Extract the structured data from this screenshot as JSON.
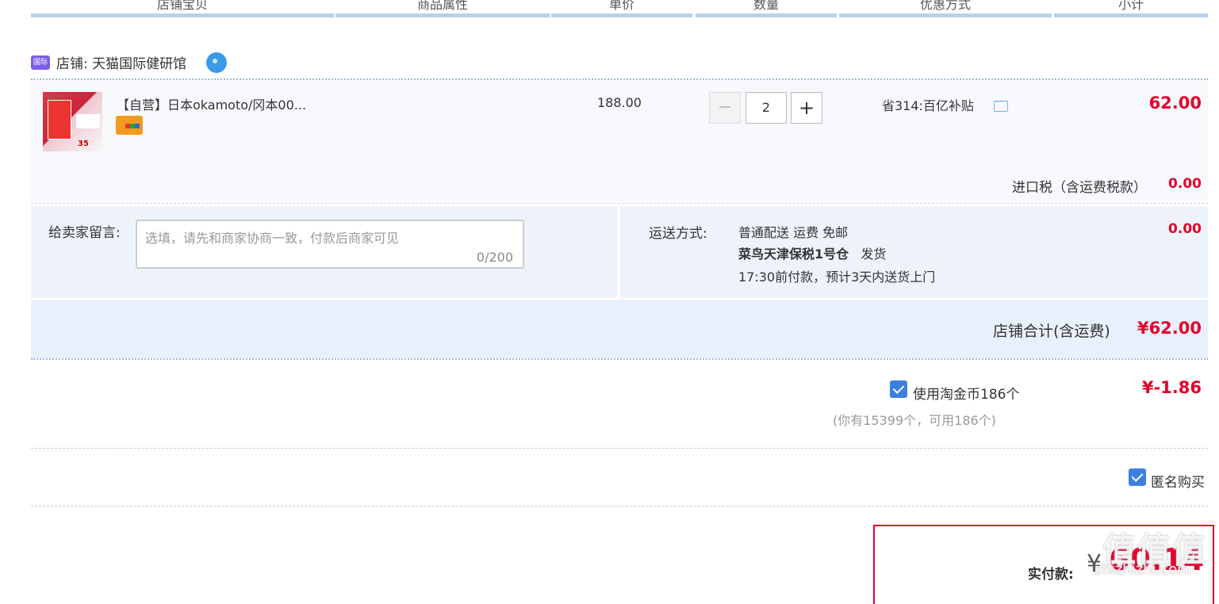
{
  "header": {
    "columns": [
      "店铺宝贝",
      "商品属性",
      "单价",
      "数量",
      "优惠方式",
      "小计"
    ]
  },
  "shop": {
    "label": "店铺: 天猫国际健研馆",
    "badge_icon": "tmall-global-icon",
    "chat_icon": "wangwang-icon"
  },
  "item": {
    "title": "【自营】日本okamoto/冈本00...",
    "price": "188.00",
    "quantity": "2",
    "promo": "省314:百亿补贴",
    "subtotal": "62.00",
    "tax_label": "进口税（含运费税款）",
    "tax_value": "0.00"
  },
  "message": {
    "label": "给卖家留言:",
    "placeholder": "选填，请先和商家协商一致，付款后商家可见",
    "counter": "0/200"
  },
  "shipping": {
    "label": "运送方式:",
    "line1": "普通配送 运费 免邮",
    "warehouse": "菜鸟天津保税1号仓",
    "dispatch": "发货",
    "line3": "17:30前付款，预计3天内送货上门",
    "fee": "0.00"
  },
  "store_total": {
    "label": "店铺合计(含运费)",
    "value": "¥62.00"
  },
  "coins": {
    "checked": true,
    "label": "使用淘金币186个",
    "sub": "(你有15399个，可用186个)",
    "value": "¥-1.86"
  },
  "anonymous": {
    "checked": true,
    "label": "匿名购买"
  },
  "payment": {
    "label": "实付款:",
    "currency": "¥",
    "value": "60.14"
  },
  "watermark": {
    "text": "值值值",
    "site": "zhizhizhi.com"
  },
  "colors": {
    "accent_red": "#e4002b",
    "header_bar": "#b8d0ee",
    "checkbox_blue": "#3b7fe0"
  }
}
